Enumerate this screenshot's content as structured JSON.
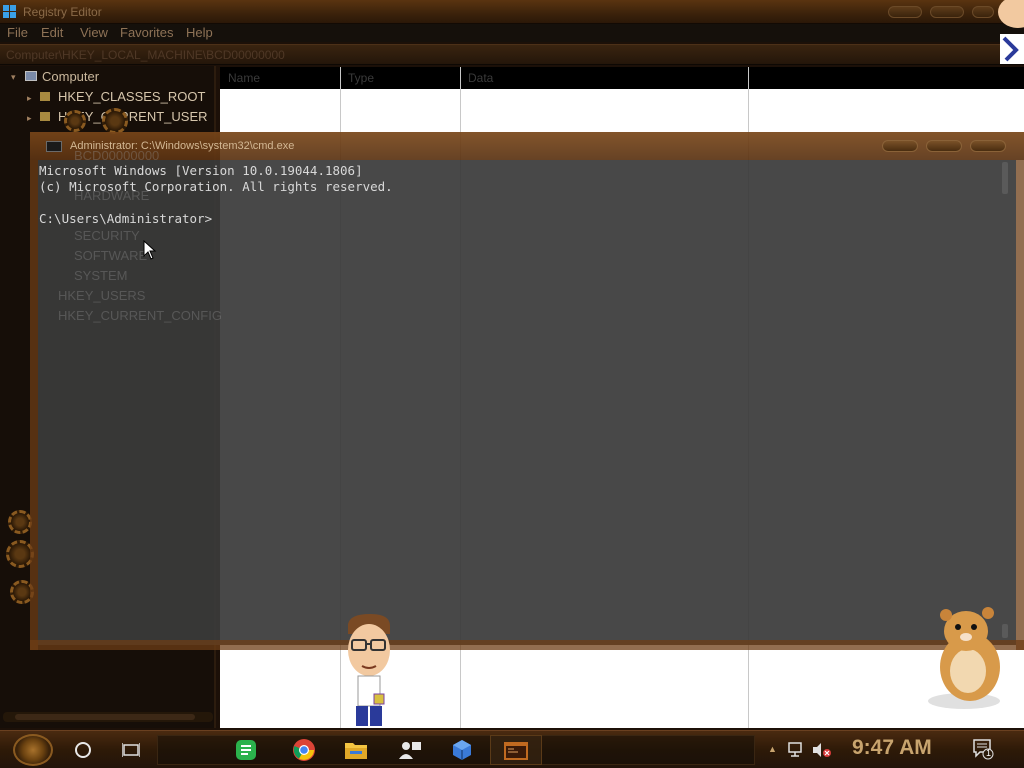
{
  "regedit": {
    "title": "Registry Editor",
    "menu": [
      "File",
      "Edit",
      "View",
      "Favorites",
      "Help"
    ],
    "address": "Computer\\HKEY_LOCAL_MACHINE\\BCD00000000",
    "tree": {
      "root": "Computer",
      "items": [
        "HKEY_CLASSES_ROOT",
        "HKEY_CURRENT_USER"
      ],
      "ghost_items": [
        "BCD00000000",
        "HARDWARE",
        "SECURITY",
        "SOFTWARE",
        "SYSTEM",
        "HKEY_USERS",
        "HKEY_CURRENT_CONFIG"
      ]
    },
    "list_columns": [
      "Name",
      "Type",
      "Data"
    ]
  },
  "cmd": {
    "title": "Administrator: C:\\Windows\\system32\\cmd.exe",
    "lines": [
      "Microsoft Windows [Version 10.0.19044.1806]",
      "(c) Microsoft Corporation. All rights reserved.",
      "",
      "C:\\Users\\Administrator>"
    ]
  },
  "taskbar": {
    "pinned": [
      {
        "name": "hangouts-icon",
        "color": "#2bb24c"
      },
      {
        "name": "chrome-icon",
        "color": "#db4437"
      },
      {
        "name": "file-explorer-icon",
        "color": "#f4c542"
      },
      {
        "name": "people-icon",
        "color": "#e8e8e8"
      },
      {
        "name": "app-cube-icon",
        "color": "#3a7ad8"
      },
      {
        "name": "cmd-taskbar-icon",
        "color": "#c06a20"
      }
    ],
    "tray_icons": [
      "network-icon",
      "volume-muted-icon"
    ],
    "clock": "9:47 AM",
    "notification_count": "1"
  }
}
